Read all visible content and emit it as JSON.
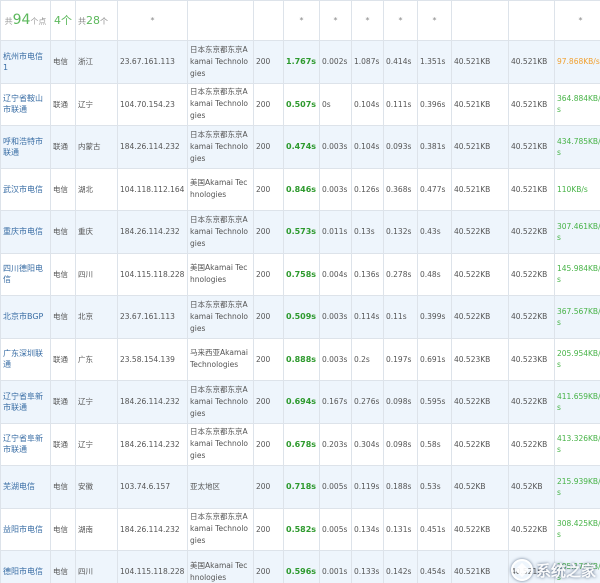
{
  "header": {
    "total_prefix": "共",
    "total_count": "94",
    "total_suffix": "个点",
    "col2": "4个",
    "col3_prefix": "共",
    "col3_count": "28",
    "col3_suffix": "个",
    "sort_mark": "*"
  },
  "rows": [
    {
      "node": "杭州市电信1",
      "isp": "电信",
      "region": "浙江",
      "ip": "23.67.161.113",
      "location": "日本东京都东京Akamai Technologies",
      "status": "200",
      "total": "1.767s",
      "dns": "0.002s",
      "connect": "1.087s",
      "ttfb": "0.414s",
      "download": "1.351s",
      "size": "40.521KB",
      "headsize": "40.521KB",
      "speed": "97.868KB/s",
      "speed_hi": true
    },
    {
      "node": "辽宁省鞍山市联通",
      "isp": "联通",
      "region": "辽宁",
      "ip": "104.70.154.23",
      "location": "日本东京都东京Akamai Technologies",
      "status": "200",
      "total": "0.507s",
      "dns": "0s",
      "connect": "0.104s",
      "ttfb": "0.111s",
      "download": "0.396s",
      "size": "40.521KB",
      "headsize": "40.521KB",
      "speed": "364.884KB/s",
      "speed_hi": false
    },
    {
      "node": "呼和浩特市联通",
      "isp": "联通",
      "region": "内蒙古",
      "ip": "184.26.114.232",
      "location": "日本东京都东京Akamai Technologies",
      "status": "200",
      "total": "0.474s",
      "dns": "0.003s",
      "connect": "0.104s",
      "ttfb": "0.093s",
      "download": "0.381s",
      "size": "40.521KB",
      "headsize": "40.521KB",
      "speed": "434.785KB/s",
      "speed_hi": false
    },
    {
      "node": "武汉市电信",
      "isp": "电信",
      "region": "湖北",
      "ip": "104.118.112.164",
      "location": "美国Akamai Technologies",
      "status": "200",
      "total": "0.846s",
      "dns": "0.003s",
      "connect": "0.126s",
      "ttfb": "0.368s",
      "download": "0.477s",
      "size": "40.521KB",
      "headsize": "40.521KB",
      "speed": "110KB/s",
      "speed_hi": false
    },
    {
      "node": "重庆市电信",
      "isp": "电信",
      "region": "重庆",
      "ip": "184.26.114.232",
      "location": "日本东京都东京Akamai Technologies",
      "status": "200",
      "total": "0.573s",
      "dns": "0.011s",
      "connect": "0.13s",
      "ttfb": "0.132s",
      "download": "0.43s",
      "size": "40.522KB",
      "headsize": "40.522KB",
      "speed": "307.461KB/s",
      "speed_hi": false
    },
    {
      "node": "四川德阳电信",
      "isp": "电信",
      "region": "四川",
      "ip": "104.115.118.228",
      "location": "美国Akamai Technologies",
      "status": "200",
      "total": "0.758s",
      "dns": "0.004s",
      "connect": "0.136s",
      "ttfb": "0.278s",
      "download": "0.48s",
      "size": "40.522KB",
      "headsize": "40.522KB",
      "speed": "145.984KB/s",
      "speed_hi": false
    },
    {
      "node": "北京市BGP",
      "isp": "电信",
      "region": "北京",
      "ip": "23.67.161.113",
      "location": "日本东京都东京Akamai Technologies",
      "status": "200",
      "total": "0.509s",
      "dns": "0.003s",
      "connect": "0.114s",
      "ttfb": "0.11s",
      "download": "0.399s",
      "size": "40.522KB",
      "headsize": "40.522KB",
      "speed": "367.567KB/s",
      "speed_hi": false
    },
    {
      "node": "广东深圳联通",
      "isp": "联通",
      "region": "广东",
      "ip": "23.58.154.139",
      "location": "马来西亚Akamai Technologies",
      "status": "200",
      "total": "0.888s",
      "dns": "0.003s",
      "connect": "0.2s",
      "ttfb": "0.197s",
      "download": "0.691s",
      "size": "40.523KB",
      "headsize": "40.523KB",
      "speed": "205.954KB/s",
      "speed_hi": false
    },
    {
      "node": "辽宁省阜新市联通",
      "isp": "联通",
      "region": "辽宁",
      "ip": "184.26.114.232",
      "location": "日本东京都东京Akamai Technologies",
      "status": "200",
      "total": "0.694s",
      "dns": "0.167s",
      "connect": "0.276s",
      "ttfb": "0.098s",
      "download": "0.595s",
      "size": "40.522KB",
      "headsize": "40.522KB",
      "speed": "411.659KB/s",
      "speed_hi": false
    },
    {
      "node": "辽宁省阜新市联通",
      "isp": "联通",
      "region": "辽宁",
      "ip": "184.26.114.232",
      "location": "日本东京都东京Akamai Technologies",
      "status": "200",
      "total": "0.678s",
      "dns": "0.203s",
      "connect": "0.304s",
      "ttfb": "0.098s",
      "download": "0.58s",
      "size": "40.522KB",
      "headsize": "40.522KB",
      "speed": "413.326KB/s",
      "speed_hi": false
    },
    {
      "node": "芜湖电信",
      "isp": "电信",
      "region": "安徽",
      "ip": "103.74.6.157",
      "location": "亚太地区",
      "status": "200",
      "total": "0.718s",
      "dns": "0.005s",
      "connect": "0.119s",
      "ttfb": "0.188s",
      "download": "0.53s",
      "size": "40.52KB",
      "headsize": "40.52KB",
      "speed": "215.939KB/s",
      "speed_hi": false
    },
    {
      "node": "益阳市电信",
      "isp": "电信",
      "region": "湖南",
      "ip": "184.26.114.232",
      "location": "日本东京都东京Akamai Technologies",
      "status": "200",
      "total": "0.582s",
      "dns": "0.005s",
      "connect": "0.134s",
      "ttfb": "0.131s",
      "download": "0.451s",
      "size": "40.522KB",
      "headsize": "40.522KB",
      "speed": "308.425KB/s",
      "speed_hi": false
    },
    {
      "node": "德阳市电信",
      "isp": "电信",
      "region": "四川",
      "ip": "104.115.118.228",
      "location": "美国Akamai Technologies",
      "status": "200",
      "total": "0.596s",
      "dns": "0.001s",
      "connect": "0.133s",
      "ttfb": "0.142s",
      "download": "0.454s",
      "size": "40.521KB",
      "headsize": "40.521KB",
      "speed": "285.176KB/s",
      "speed_hi": false
    }
  ],
  "watermark": {
    "text": "系统之家"
  }
}
